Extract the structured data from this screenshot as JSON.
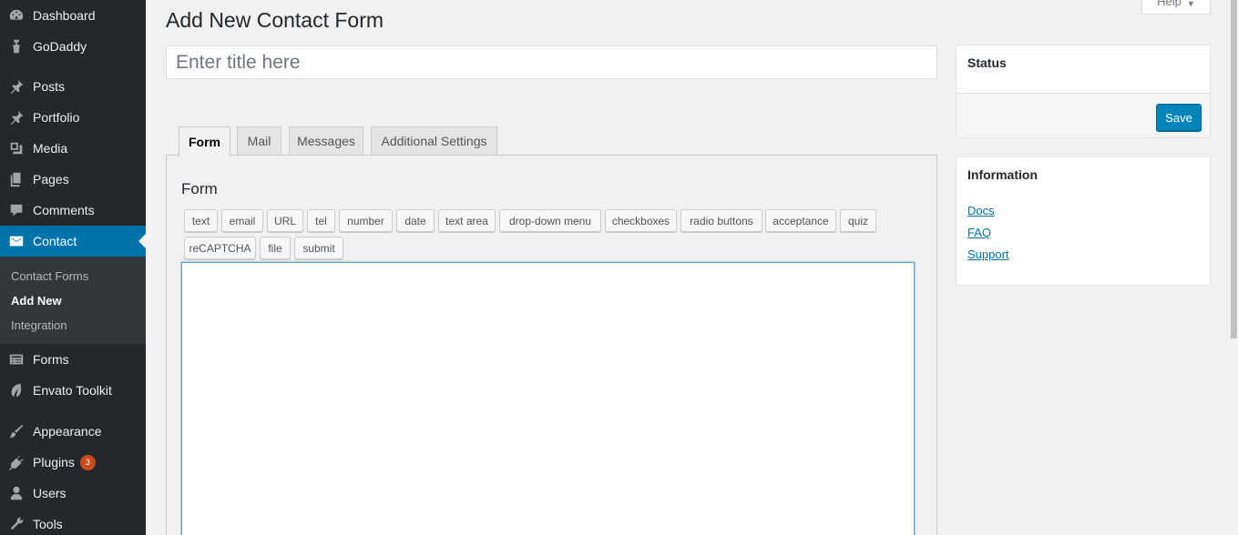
{
  "sidebar": {
    "items": [
      {
        "label": "Dashboard",
        "icon": "dashboard-icon"
      },
      {
        "label": "GoDaddy",
        "icon": "godaddy-icon"
      },
      {
        "label": "Posts",
        "icon": "pin-icon"
      },
      {
        "label": "Portfolio",
        "icon": "pin-icon"
      },
      {
        "label": "Media",
        "icon": "media-icon"
      },
      {
        "label": "Pages",
        "icon": "pages-icon"
      },
      {
        "label": "Comments",
        "icon": "comment-icon"
      },
      {
        "label": "Contact",
        "icon": "envelope-icon"
      },
      {
        "label": "Forms",
        "icon": "forms-icon"
      },
      {
        "label": "Envato Toolkit",
        "icon": "leaf-icon"
      },
      {
        "label": "Appearance",
        "icon": "brush-icon"
      },
      {
        "label": "Plugins",
        "icon": "plugin-icon",
        "badge": "3"
      },
      {
        "label": "Users",
        "icon": "user-icon"
      },
      {
        "label": "Tools",
        "icon": "wrench-icon"
      }
    ],
    "submenu": [
      "Contact Forms",
      "Add New",
      "Integration"
    ]
  },
  "header": {
    "title": "Add New Contact Form",
    "help_label": "Help"
  },
  "title_input": {
    "placeholder": "Enter title here",
    "value": ""
  },
  "tabs": [
    "Form",
    "Mail",
    "Messages",
    "Additional Settings"
  ],
  "form_panel": {
    "heading": "Form",
    "tag_buttons": [
      "text",
      "email",
      "URL",
      "tel",
      "number",
      "date",
      "text area",
      "drop-down menu",
      "checkboxes",
      "radio buttons",
      "acceptance",
      "quiz",
      "reCAPTCHA",
      "file",
      "submit"
    ]
  },
  "status_box": {
    "title": "Status",
    "save_label": "Save"
  },
  "info_box": {
    "title": "Information",
    "links": [
      "Docs",
      "FAQ",
      "Support"
    ]
  },
  "colors": {
    "sidebar_bg": "#23282d",
    "active_bg": "#0073aa",
    "primary_button": "#0085ba",
    "badge": "#ca4a1f"
  }
}
